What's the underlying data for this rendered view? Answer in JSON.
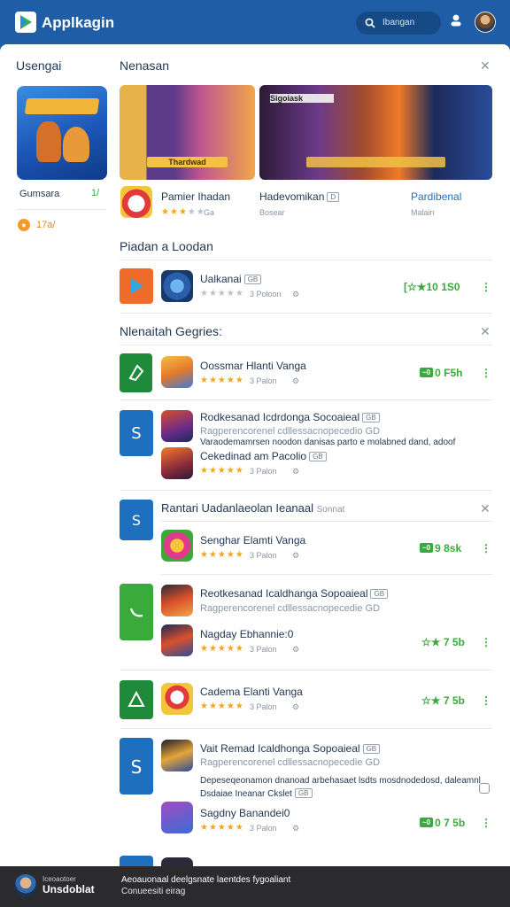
{
  "app": {
    "title": "Applkagin"
  },
  "header": {
    "search_placeholder": "Ibangan"
  },
  "sidebar": {
    "title": "Usengai",
    "item_label": "Gumsara",
    "item_count": "1/",
    "badge_text": "17a/"
  },
  "featured": {
    "title": "Nenasan",
    "image1_caption": "Thardwad",
    "image2_title": "Sigoiask",
    "items": [
      {
        "name": "Pamier Ihadan",
        "meta": "Ga",
        "stars": 3
      },
      {
        "name": "Hadevomikan",
        "badge": "D",
        "sub": "Bosear"
      },
      {
        "name": "Pardibenal",
        "sub": "Malain"
      }
    ]
  },
  "section_popular": {
    "title": "Piadan a Loodan",
    "row": {
      "title": "Ualkanai",
      "pill": "GB",
      "meta": "3 Poloon",
      "price": "[☆★10 1S0"
    }
  },
  "section_reviews": {
    "title": "Nlenaitah Gegries:",
    "rows": [
      {
        "title": "Oossmar Hlanti Vanga",
        "meta": "3 Palon",
        "price_tag": "~0",
        "price": "0 F5h"
      },
      {
        "title": "Rodkesanad Icdrdonga Socoaieal",
        "pill": "GB",
        "sub": "Ragperencorenel cdllessacnopecedio GD",
        "desc": "Varaodemamrsen noodon danisas parto e molabned dand, adoof",
        "extra": "Cekedinad am Pacolio",
        "extra_pill": "GB",
        "meta": "3 Palon"
      }
    ]
  },
  "section_related": {
    "title": "Rantari Uadanlaeolan Ieanaal",
    "title_suffix": "Sonnat",
    "rows": [
      {
        "title": "Senghar Elamti Vanga",
        "meta": "3 Palon",
        "price_tag": "~0",
        "price": "9 8sk"
      },
      {
        "title": "Reotkesanad Icaldhanga Sopoaieal",
        "pill": "GB",
        "sub": "Ragperencorenel cdllessacnopecedie GD",
        "sub2": "Nagday Ebhannie:0",
        "meta": "3 Palon",
        "price": "☆★ 7 5b"
      },
      {
        "title": "Cadema Elanti Vanga",
        "meta": "3 Palon",
        "price": "☆★ 7 5b"
      },
      {
        "title": "Vait Remad Icaldhonga Sopoaieal",
        "pill": "GB",
        "sub": "Ragperencorenel cdllessacnopecedie GD",
        "desc": "Depeseqeonamon dnanoad arbehasaet lsdts mosdnodedosd, daleamnl",
        "extra": "Dsdaiae Ineanar Ckslet",
        "extra_pill": "GB",
        "sub2": "Sagdny Banandei0",
        "meta": "3 Palon",
        "price_tag": "~0",
        "price": "0 7 5b"
      }
    ]
  },
  "bottom": {
    "user_small": "Iceoaotoer",
    "user": "Unsdoblat",
    "message1": "Aeoauonaal deelgsnate laentdes fygoaliant",
    "message2": "Conueesiti eirag"
  }
}
